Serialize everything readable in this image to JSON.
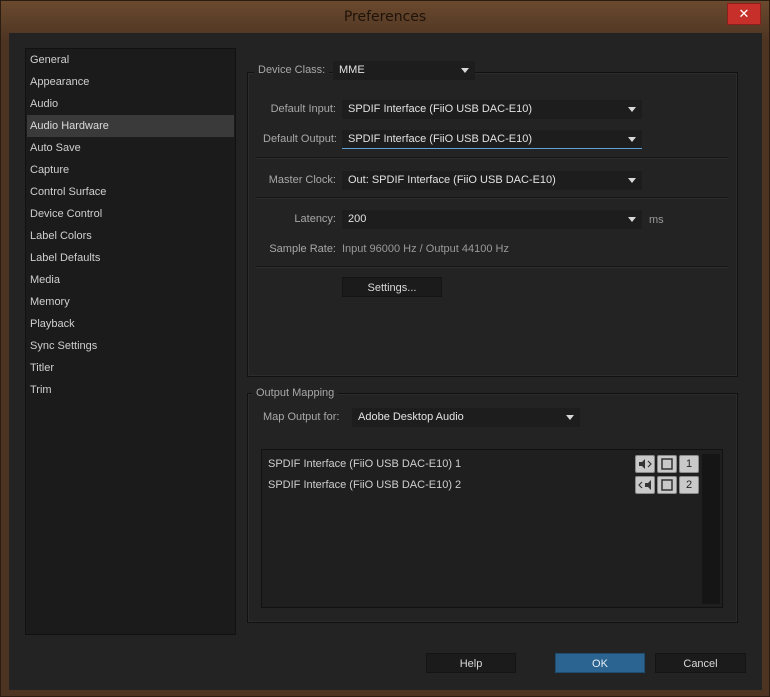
{
  "window": {
    "title": "Preferences",
    "close_glyph": "✕"
  },
  "sidebar": {
    "items": [
      {
        "label": "General"
      },
      {
        "label": "Appearance"
      },
      {
        "label": "Audio"
      },
      {
        "label": "Audio Hardware"
      },
      {
        "label": "Auto Save"
      },
      {
        "label": "Capture"
      },
      {
        "label": "Control Surface"
      },
      {
        "label": "Device Control"
      },
      {
        "label": "Label Colors"
      },
      {
        "label": "Label Defaults"
      },
      {
        "label": "Media"
      },
      {
        "label": "Memory"
      },
      {
        "label": "Playback"
      },
      {
        "label": "Sync Settings"
      },
      {
        "label": "Titler"
      },
      {
        "label": "Trim"
      }
    ],
    "selected": "Audio Hardware"
  },
  "device": {
    "class_label": "Device Class:",
    "class_value": "MME",
    "input_label": "Default Input:",
    "input_value": "SPDIF Interface (FiiO USB DAC-E10)",
    "output_label": "Default Output:",
    "output_value": "SPDIF Interface (FiiO USB DAC-E10)",
    "clock_label": "Master Clock:",
    "clock_value": "Out: SPDIF Interface (FiiO USB DAC-E10)",
    "latency_label": "Latency:",
    "latency_value": "200",
    "latency_unit": "ms",
    "sample_rate_label": "Sample Rate:",
    "sample_rate_value": "Input 96000 Hz / Output 44100 Hz",
    "settings_button": "Settings..."
  },
  "output_mapping": {
    "group_label": "Output Mapping",
    "map_label": "Map Output for:",
    "map_value": "Adobe Desktop Audio",
    "channels": [
      {
        "name": "SPDIF Interface (FiiO USB DAC-E10) 1",
        "number": "1",
        "speaker_icon": "left-speaker-icon"
      },
      {
        "name": "SPDIF Interface (FiiO USB DAC-E10) 2",
        "number": "2",
        "speaker_icon": "right-speaker-icon"
      }
    ]
  },
  "buttons": {
    "help": "Help",
    "ok": "OK",
    "cancel": "Cancel"
  },
  "colors": {
    "accent": "#2b6490",
    "focus": "#5fa3d8",
    "close": "#c7302a"
  }
}
